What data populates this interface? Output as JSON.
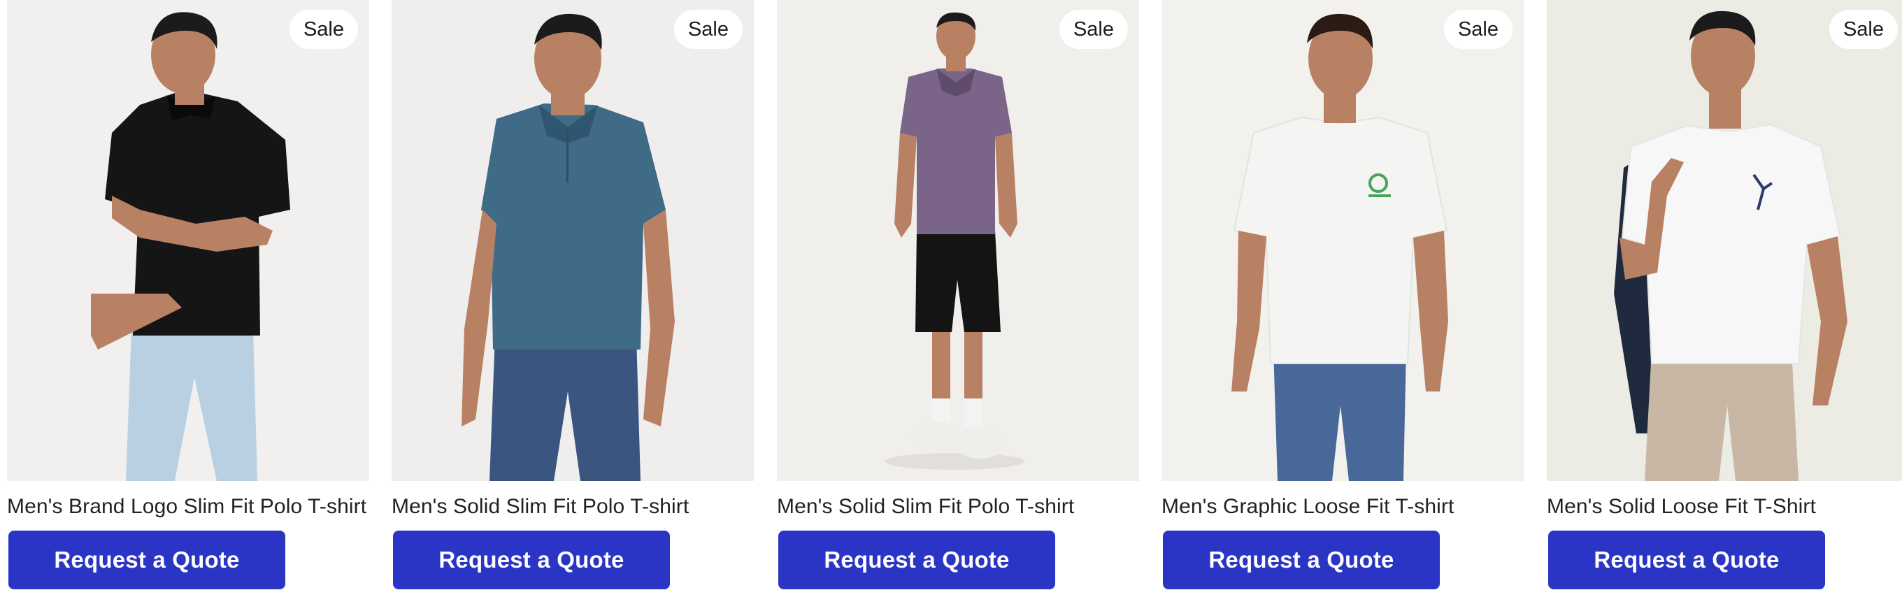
{
  "products": [
    {
      "title": "Men's Brand Logo Slim Fit Polo T-shirt",
      "badge": "Sale",
      "button_label": "Request a Quote",
      "shirt_color": "#151515",
      "bottom_color": "#b9d0e2",
      "background_color": "#f1f0ee"
    },
    {
      "title": "Men's Solid Slim Fit Polo T-shirt",
      "badge": "Sale",
      "button_label": "Request a Quote",
      "shirt_color": "#3f6b86",
      "bottom_color": "#3a5680",
      "background_color": "#efeeec"
    },
    {
      "title": "Men's Solid Slim Fit Polo T-shirt",
      "badge": "Sale",
      "button_label": "Request a Quote",
      "shirt_color": "#7a6488",
      "bottom_color": "#141414",
      "background_color": "#f1efec"
    },
    {
      "title": "Men's Graphic Loose Fit T-shirt",
      "badge": "Sale",
      "button_label": "Request a Quote",
      "shirt_color": "#f4f4f2",
      "bottom_color": "#48689a",
      "background_color": "#f2f1ee"
    },
    {
      "title": "Men's Solid Loose Fit T-Shirt",
      "badge": "Sale",
      "button_label": "Request a Quote",
      "shirt_color": "#f7f7f7",
      "bottom_color": "#c9b7a5",
      "background_color": "#ecebe4"
    }
  ],
  "theme": {
    "button_color": "#2a35c5",
    "button_text_color": "#ffffff",
    "title_color": "#222222",
    "skin_color": "#b98163",
    "hair_color": "#1b1b1b"
  }
}
